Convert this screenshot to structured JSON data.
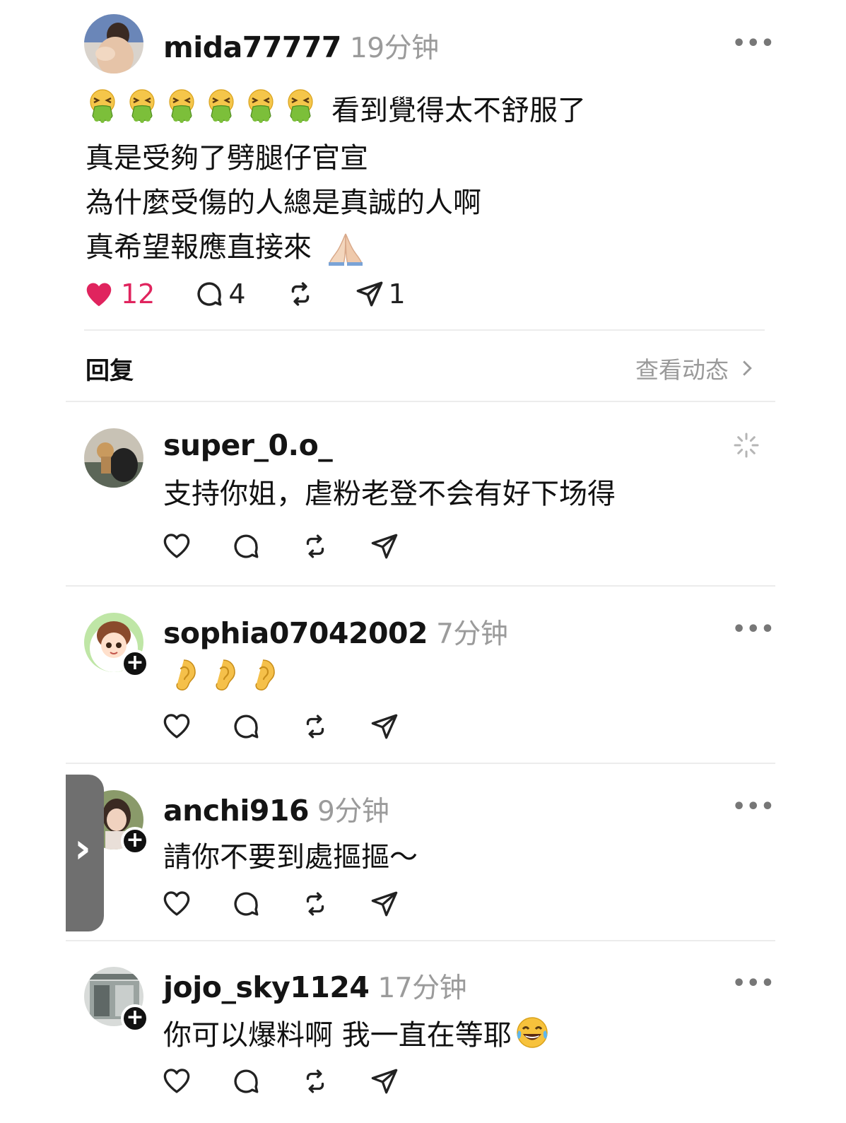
{
  "post": {
    "username": "mida77777",
    "time": "19分钟",
    "emoji_count": 6,
    "line1_text": "看到覺得太不舒服了",
    "line2": "真是受夠了劈腿仔官宣",
    "line3": "為什麼受傷的人總是真誠的人啊",
    "line4_text": "真希望報應直接來",
    "likes": "12",
    "comments": "4",
    "shares": "1",
    "accent_like_color": "#e0245e"
  },
  "reply_bar": {
    "label": "回复",
    "view_activity": "查看动态"
  },
  "comments": [
    {
      "username": "super_0.o_",
      "time": "",
      "text": "支持你姐，虐粉老登不会有好下场得",
      "status_icon": "loading-spinner-icon"
    },
    {
      "username": "sophia07042002",
      "time": "7分钟",
      "text": "",
      "emoji": "ear-icon",
      "emoji_count": 3,
      "status_icon": "more-icon"
    },
    {
      "username": "anchi916",
      "time": "9分钟",
      "text": "請你不要到處摳摳～",
      "status_icon": "more-icon"
    },
    {
      "username": "jojo_sky1124",
      "time": "17分钟",
      "text": "你可以爆料啊 我一直在等耶",
      "emoji": "tears-of-joy-icon",
      "status_icon": "more-icon"
    }
  ]
}
